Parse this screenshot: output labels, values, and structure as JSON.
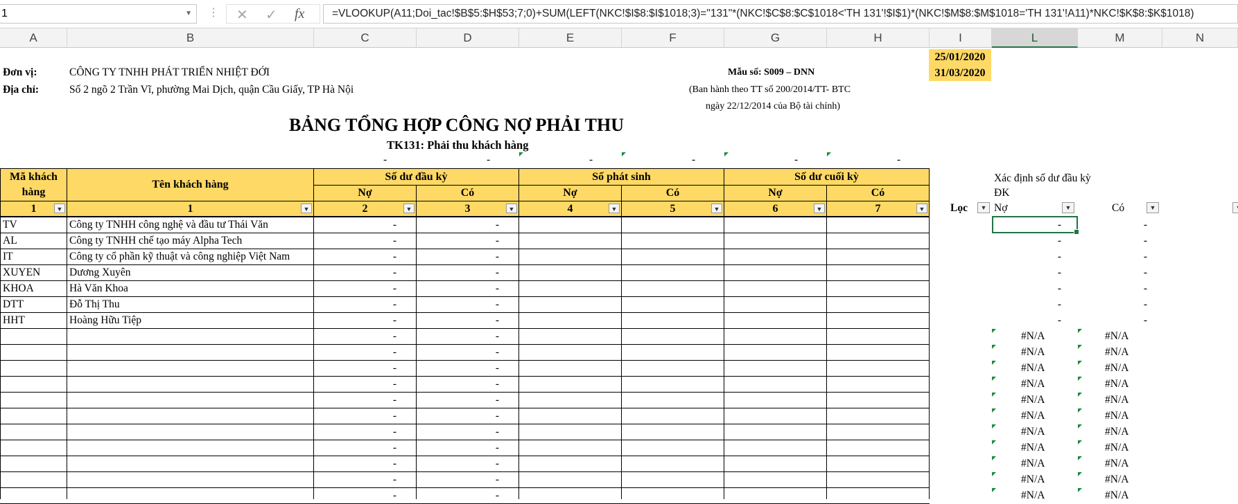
{
  "formula_bar": {
    "name_box": "1",
    "fx_label": "fx",
    "cancel_glyph": "✕",
    "enter_glyph": "✓",
    "formula": "=VLOOKUP(A11;Doi_tac!$B$5:$H$53;7;0)+SUM(LEFT(NKC!$I$8:$I$1018;3)=\"131\"*(NKC!$C$8:$C$1018<'TH 131'!$I$1)*(NKC!$M$8:$M$1018='TH 131'!A11)*NKC!$K$8:$K$1018)"
  },
  "columns": [
    "A",
    "B",
    "C",
    "D",
    "E",
    "F",
    "G",
    "H",
    "I",
    "L",
    "M",
    "N"
  ],
  "selected_column": "L",
  "header": {
    "unit_label": "Đơn vị:",
    "unit_value": "CÔNG TY TNHH PHÁT TRIỂN NHIỆT ĐỚI",
    "address_label": "Địa chỉ:",
    "address_value": "Số 2 ngõ 2 Trần Vĩ, phường Mai Dịch, quận Cầu Giấy, TP Hà Nội",
    "form_no": "Mẫu số: S009 – DNN",
    "issued_line1": "(Ban hành theo TT số 200/2014/TT- BTC",
    "issued_line2": "ngày 22/12/2014 của Bộ tài chính)",
    "date_from": "25/01/2020",
    "date_to": "31/03/2020",
    "title": "BẢNG TỔNG HỢP CÔNG NỢ PHẢI THU",
    "subtitle": "TK131: Phải thu khách hàng",
    "dash": "-"
  },
  "table_header": {
    "ma_kh": "Mã khách hàng",
    "ten_kh": "Tên khách hàng",
    "so_du_dau_ky": "Số dư đầu kỳ",
    "so_phat_sinh": "Số phát sinh",
    "so_du_cuoi_ky": "Số dư cuối kỳ",
    "no": "Nợ",
    "co": "Có",
    "index_row": [
      "1",
      "1",
      "2",
      "3",
      "4",
      "5",
      "6",
      "7"
    ]
  },
  "side": {
    "title_line1": "Xác định số dư đầu kỳ",
    "title_line2": "ĐK",
    "loc": "Lọc",
    "no": "Nợ",
    "co": "Có"
  },
  "rows": [
    {
      "code": "TV",
      "name": "Công ty TNHH công nghệ và đầu tư Thái Văn",
      "c": "-",
      "d": "-",
      "l": "-",
      "m": "-"
    },
    {
      "code": "AL",
      "name": "Công ty TNHH chế tạo máy Alpha Tech",
      "c": "-",
      "d": "-",
      "l": "-",
      "m": "-"
    },
    {
      "code": "IT",
      "name": "Công ty cổ phần kỹ thuật và công nghiệp Việt Nam",
      "c": "-",
      "d": "-",
      "l": "-",
      "m": "-"
    },
    {
      "code": "XUYEN",
      "name": "Dương Xuyên",
      "c": "-",
      "d": "-",
      "l": "-",
      "m": "-"
    },
    {
      "code": "KHOA",
      "name": "Hà Văn Khoa",
      "c": "-",
      "d": "-",
      "l": "-",
      "m": "-"
    },
    {
      "code": "DTT",
      "name": "Đỗ Thị Thu",
      "c": "-",
      "d": "-",
      "l": "-",
      "m": "-"
    },
    {
      "code": "HHT",
      "name": "Hoàng Hữu Tiệp",
      "c": "-",
      "d": "-",
      "l": "-",
      "m": "-"
    },
    {
      "code": "",
      "name": "",
      "c": "-",
      "d": "-",
      "l": "#N/A",
      "m": "#N/A"
    },
    {
      "code": "",
      "name": "",
      "c": "-",
      "d": "-",
      "l": "#N/A",
      "m": "#N/A"
    },
    {
      "code": "",
      "name": "",
      "c": "-",
      "d": "-",
      "l": "#N/A",
      "m": "#N/A"
    },
    {
      "code": "",
      "name": "",
      "c": "-",
      "d": "-",
      "l": "#N/A",
      "m": "#N/A"
    },
    {
      "code": "",
      "name": "",
      "c": "-",
      "d": "-",
      "l": "#N/A",
      "m": "#N/A"
    },
    {
      "code": "",
      "name": "",
      "c": "-",
      "d": "-",
      "l": "#N/A",
      "m": "#N/A"
    },
    {
      "code": "",
      "name": "",
      "c": "-",
      "d": "-",
      "l": "#N/A",
      "m": "#N/A"
    },
    {
      "code": "",
      "name": "",
      "c": "-",
      "d": "-",
      "l": "#N/A",
      "m": "#N/A"
    },
    {
      "code": "",
      "name": "",
      "c": "-",
      "d": "-",
      "l": "#N/A",
      "m": "#N/A"
    },
    {
      "code": "",
      "name": "",
      "c": "-",
      "d": "-",
      "l": "#N/A",
      "m": "#N/A"
    },
    {
      "code": "",
      "name": "",
      "c": "-",
      "d": "-",
      "l": "#N/A",
      "m": "#N/A"
    }
  ],
  "colors": {
    "header_fill": "#ffd966",
    "accent": "#217346",
    "error_tri": "#1e8a3c"
  }
}
